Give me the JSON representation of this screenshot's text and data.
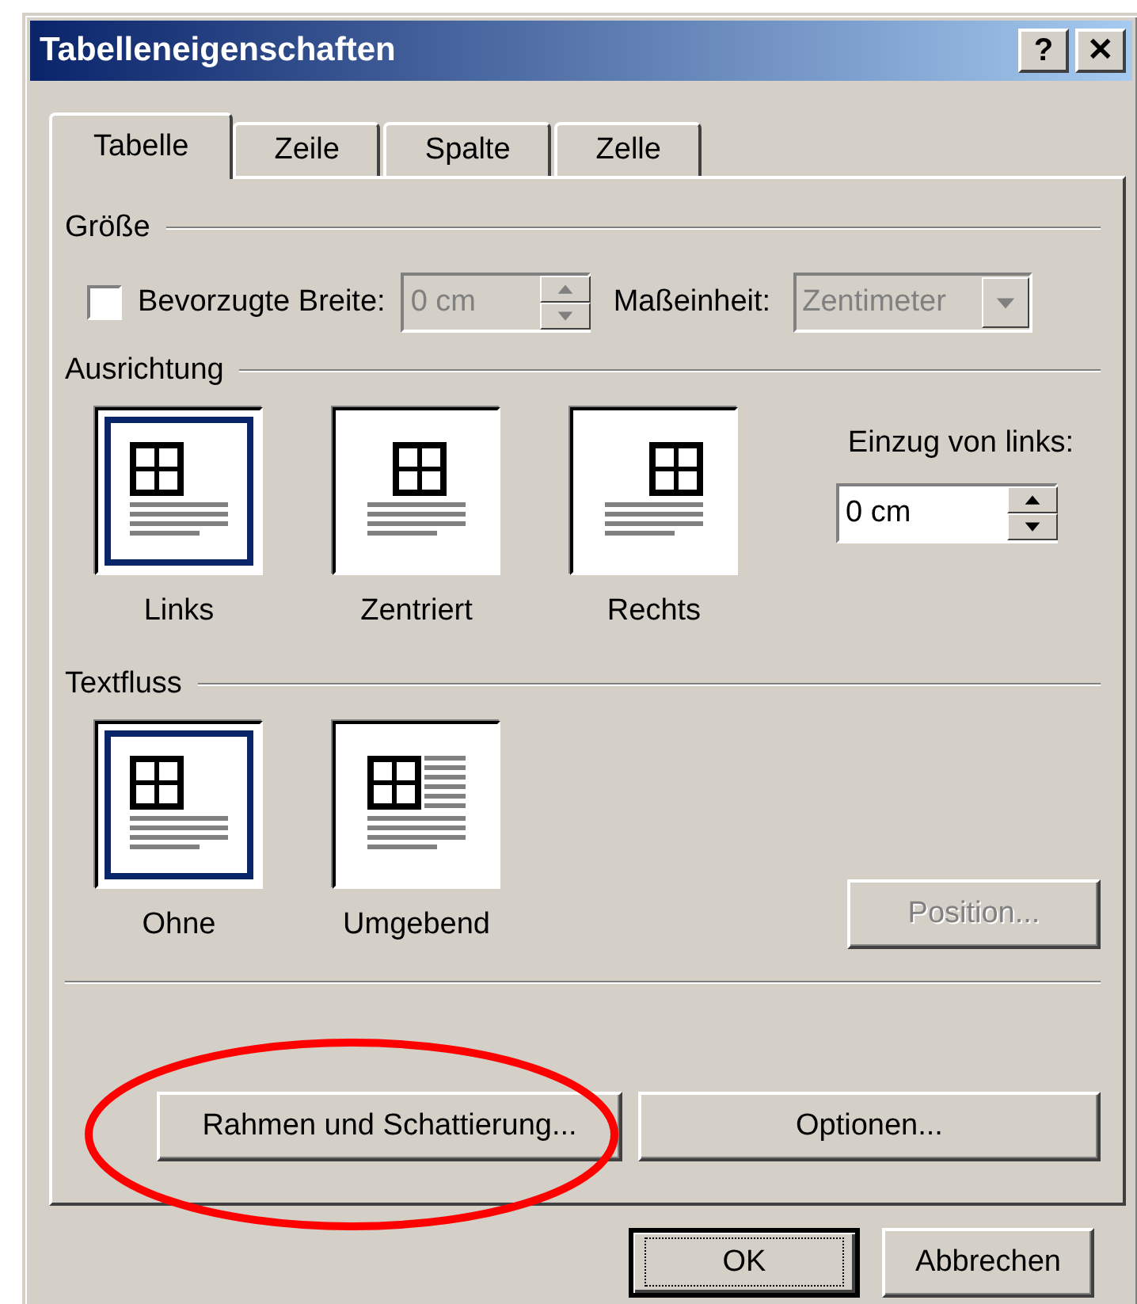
{
  "window": {
    "title": "Tabelleneigenschaften",
    "help_button": "?",
    "close_button": "✕"
  },
  "tabs": [
    {
      "label": "Tabelle",
      "selected": true
    },
    {
      "label": "Zeile",
      "selected": false
    },
    {
      "label": "Spalte",
      "selected": false
    },
    {
      "label": "Zelle",
      "selected": false
    }
  ],
  "size": {
    "title": "Größe",
    "preferred_width": {
      "label": "Bevorzugte Breite:",
      "checked": false,
      "value": "0 cm",
      "disabled": true
    },
    "unit": {
      "label": "Maßeinheit:",
      "value": "Zentimeter",
      "disabled": true
    }
  },
  "alignment": {
    "title": "Ausrichtung",
    "options": [
      {
        "label": "Links",
        "kind": "left",
        "selected": true
      },
      {
        "label": "Zentriert",
        "kind": "center",
        "selected": false
      },
      {
        "label": "Rechts",
        "kind": "right",
        "selected": false
      }
    ],
    "indent": {
      "label": "Einzug von links:",
      "value": "0 cm"
    }
  },
  "text_wrap": {
    "title": "Textfluss",
    "options": [
      {
        "label": "Ohne",
        "kind": "left",
        "selected": true
      },
      {
        "label": "Umgebend",
        "kind": "around",
        "selected": false
      }
    ],
    "position_button": {
      "label": "Position...",
      "disabled": true
    }
  },
  "panel_buttons": [
    {
      "label": "Rahmen und Schattierung..."
    },
    {
      "label": "Optionen..."
    }
  ],
  "dialog_buttons": [
    {
      "label": "OK",
      "default": true
    },
    {
      "label": "Abbrechen",
      "default": false
    }
  ],
  "annotation": {
    "kind": "ellipse"
  }
}
